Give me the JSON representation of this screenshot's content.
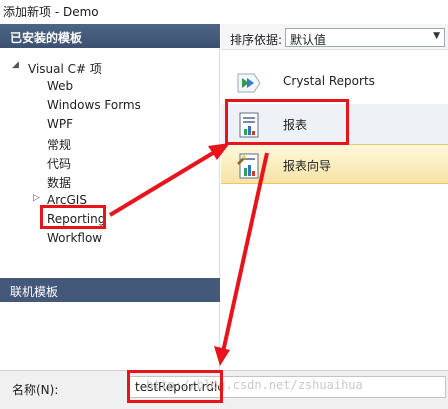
{
  "window": {
    "title": "添加新项 - Demo"
  },
  "installed_templates": {
    "header": "已安装的模板",
    "tree": [
      {
        "label": "Visual C# 项",
        "arrow": "◢",
        "level": 0
      },
      {
        "label": "Web",
        "arrow": "",
        "level": 1
      },
      {
        "label": "Windows Forms",
        "arrow": "",
        "level": 1
      },
      {
        "label": "WPF",
        "arrow": "",
        "level": 1
      },
      {
        "label": "常规",
        "arrow": "",
        "level": 1
      },
      {
        "label": "代码",
        "arrow": "",
        "level": 1
      },
      {
        "label": "数据",
        "arrow": "",
        "level": 1
      },
      {
        "label": "ArcGIS",
        "arrow": "▷",
        "level": 1
      },
      {
        "label": "Reporting",
        "arrow": "",
        "level": 1
      },
      {
        "label": "Workflow",
        "arrow": "",
        "level": 1
      }
    ]
  },
  "online_templates": {
    "header": "联机模板"
  },
  "sort": {
    "label": "排序依据:",
    "selected": "默认值"
  },
  "templates": [
    {
      "label": "Crystal Reports",
      "icon": "crystal-reports-icon"
    },
    {
      "label": "报表",
      "icon": "report-icon"
    },
    {
      "label": "报表向导",
      "icon": "report-wizard-icon"
    }
  ],
  "bottom": {
    "name_label": "名称(N):",
    "name_value": "testReport.rdlc",
    "watermark": "http://blog.csdn.net/zshuaihua"
  },
  "colors": {
    "accent_red": "#e8141c",
    "header_blue": "#44597a",
    "selected_gold": "#f7e3a5"
  }
}
